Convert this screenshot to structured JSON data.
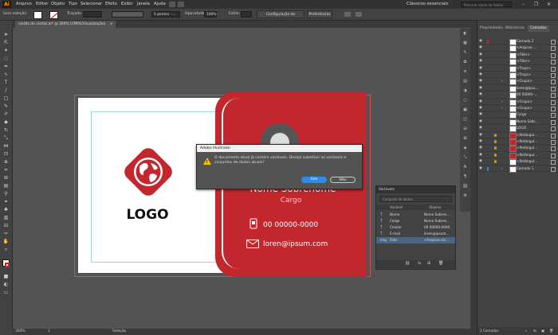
{
  "app": {
    "logo": "Ai",
    "menu": [
      "Arquivo",
      "Editar",
      "Objeto",
      "Tipo",
      "Selecionar",
      "Efeito",
      "Exibir",
      "Janela",
      "Ajuda"
    ],
    "workspace": "Clássicos essenciais",
    "search_placeholder": "Procurar ajuda do Adobe",
    "window_controls": [
      "–",
      "❐",
      "✕"
    ]
  },
  "control_bar": {
    "selection_label": "Sem seleção",
    "stroke_label": "Traçado",
    "brush_label": "5 pontos - ...",
    "opacity_label": "Opacidade:",
    "opacity_value": "100%",
    "style_label": "Estilo:",
    "doc_setup_button": "Configuração do documento",
    "prefs_button": "Preferências"
  },
  "document_tab": {
    "title": "cartão de visitas.ai* @ 300% (CMYK/Visualização)",
    "close": "×"
  },
  "status_bar": {
    "zoom": "300%",
    "page": "1",
    "tool_name": "Seleção"
  },
  "artwork": {
    "logo_text": "LOGO",
    "name_text": "Nome Sobrenome",
    "cargo_text": "Cargo",
    "phone": "00 00000-0000",
    "email": "loren@ipsum.com",
    "brand_red": "#c1272d"
  },
  "dialog": {
    "title": "Adobe Illustrator",
    "message": "O documento atual já contém variáveis. Deseja substituir as variáveis e conjuntos de dados atuais?",
    "yes": "Sim",
    "no": "Não"
  },
  "variables_panel": {
    "tab": "Variáveis",
    "dataset_placeholder": "Conjunto de dados",
    "col_variable": "Variável",
    "col_object": "Objetos",
    "rows": [
      {
        "type": "T",
        "name": "Nome",
        "object": "Nome Sobren..."
      },
      {
        "type": "T",
        "name": "Cargo",
        "object": "Nome Sobren..."
      },
      {
        "type": "T",
        "name": "Celular",
        "object": "00 00000-0000"
      },
      {
        "type": "T",
        "name": "E-mail",
        "object": "loren@ipsum..."
      },
      {
        "type": "img",
        "name": "Foto",
        "object": "<Arquivo vin..."
      }
    ]
  },
  "layers_panel": {
    "tabs": [
      "Propriedades",
      "Bibliotecas",
      "Camadas"
    ],
    "rows": [
      "Camada 2",
      "<Arquivo ...",
      "<Filler>",
      "<Filler>",
      "<Traço>",
      "<Traço>",
      "<Grupo>",
      "loren@ipsu...",
      "00 00000-...",
      "<Grupo>",
      "<Grupo>",
      "Cargo",
      "Nome Sobr...",
      "LOGO",
      "<Retângul...",
      "<Retângul...",
      "<Retângul...",
      "<Retângul...",
      "<Retângul...",
      "Camada 1"
    ],
    "footer": "2 Camadas"
  }
}
